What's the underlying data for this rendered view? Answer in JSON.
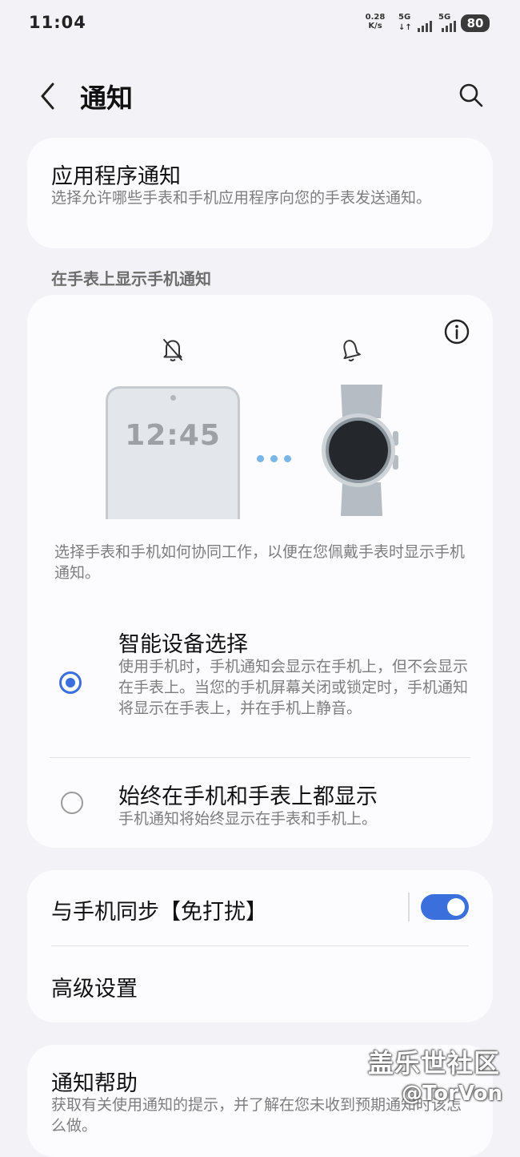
{
  "status_bar": {
    "time": "11:04",
    "net_speed_value": "0.28",
    "net_speed_unit": "K/s",
    "signal_1": "5G",
    "signal_2": "5G",
    "battery": "80"
  },
  "header": {
    "back_icon": "chevron-left-icon",
    "title": "通知",
    "search_icon": "search-icon"
  },
  "app_notifications": {
    "title": "应用程序通知",
    "description": "选择允许哪些手表和手机应用程序向您的手表发送通知。"
  },
  "section_header": "在手表上显示手机通知",
  "display_card": {
    "info_icon": "info-icon",
    "phone_bell_icon": "bell-off-icon",
    "watch_bell_icon": "bell-icon",
    "phone_clock": "12:45",
    "description": "选择手表和手机如何协同工作，以便在您佩戴手表时显示手机通知。",
    "options": [
      {
        "title": "智能设备选择",
        "description": "使用手机时，手机通知会显示在手机上，但不会显示在手表上。当您的手机屏幕关闭或锁定时，手机通知将显示在手表上，并在手机上静音。",
        "selected": true
      },
      {
        "title": "始终在手机和手表上都显示",
        "description": "手机通知将始终显示在手表和手机上。",
        "selected": false
      }
    ]
  },
  "settings_card": {
    "sync_label": "与手机同步【免打扰】",
    "sync_enabled": true,
    "advanced_label": "高级设置"
  },
  "help_card": {
    "title": "通知帮助",
    "description": "获取有关使用通知的提示，并了解在您未收到预期通知时该怎么做。"
  },
  "watermark": {
    "site": "盖乐世社区",
    "user": "@TorVon"
  },
  "colors": {
    "accent": "#3a6fdc",
    "background": "#f3f3f7",
    "card": "#fcfcfe"
  }
}
